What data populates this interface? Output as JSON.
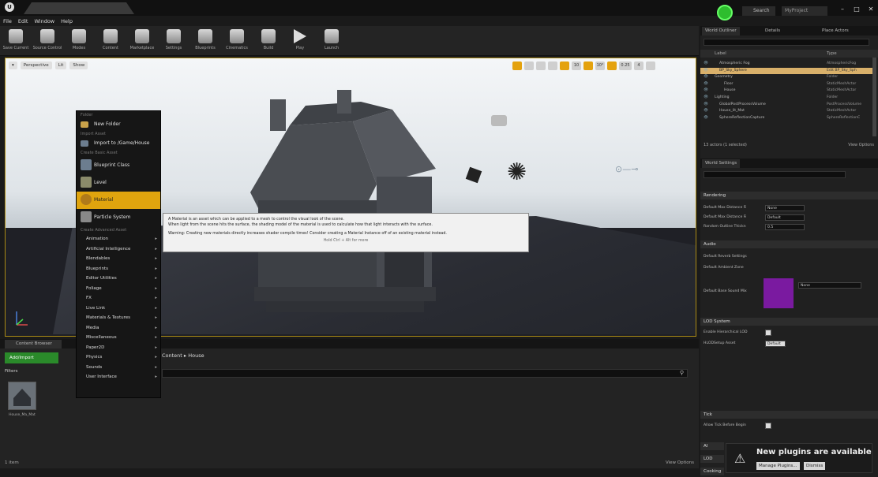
{
  "window": {
    "menu": [
      "File",
      "Edit",
      "Window",
      "Help"
    ],
    "search_label": "Search",
    "project_label": "MyProject"
  },
  "toolbar": {
    "buttons": [
      "Save Current",
      "Source Control",
      "Modes",
      "Content",
      "Marketplace",
      "Settings",
      "Blueprints",
      "Cinematics",
      "Build",
      "Play",
      "Launch"
    ]
  },
  "viewport": {
    "perspective": "Perspective",
    "lit": "Lit",
    "show": "Show",
    "snap_values": [
      "10",
      "10°",
      "0.25",
      "4"
    ]
  },
  "context_menu": {
    "folder_section": "Folder",
    "new_folder": "New Folder",
    "import_section": "Import Asset",
    "import_to": "Import to /Game/House",
    "basic_section": "Create Basic Asset",
    "basic_items": [
      "Blueprint Class",
      "Level",
      "Material",
      "Particle System"
    ],
    "advanced_section": "Create Advanced Asset",
    "advanced_items": [
      "Animation",
      "Artificial Intelligence",
      "Blendables",
      "Blueprints",
      "Editor Utilities",
      "Foliage",
      "FX",
      "Live Link",
      "Materials & Textures",
      "Media",
      "Miscellaneous",
      "Paper2D",
      "Physics",
      "Sounds",
      "User Interface"
    ]
  },
  "tooltip": {
    "line1": "A Material is an asset which can be applied to a mesh to control the visual look of the scene.",
    "line2": "When light from the scene hits the surface, the shading model of the material is used to calculate how that light interacts with the surface.",
    "line3": "Warning: Creating new materials directly increases shader compile times! Consider creating a Material Instance off of an existing material instead.",
    "hint": "Hold Ctrl + Alt for more"
  },
  "content_browser": {
    "tab": "Content Browser",
    "add_new": "Add/Import",
    "path": "Content ▸ House",
    "filters": "Filters",
    "asset_name": "House_Ma_Mat",
    "status": "1 item",
    "view_options": "View Options"
  },
  "outliner": {
    "tabs": [
      "World Outliner",
      "Details",
      "Place Actors"
    ],
    "columns": [
      "Label",
      "Type"
    ],
    "rows": [
      {
        "name": "Atmospheric Fog",
        "type": "AtmosphericFog",
        "indent": 1,
        "selected": false
      },
      {
        "name": "BP_Sky_Sphere",
        "type": "Edit BP_Sky_Sph",
        "indent": 1,
        "selected": true
      },
      {
        "name": "Geometry",
        "type": "Folder",
        "indent": 0,
        "selected": false
      },
      {
        "name": "Floor",
        "type": "StaticMeshActor",
        "indent": 2,
        "selected": false
      },
      {
        "name": "House",
        "type": "StaticMeshActor",
        "indent": 2,
        "selected": false
      },
      {
        "name": "Lighting",
        "type": "Folder",
        "indent": 0,
        "selected": false
      },
      {
        "name": "GlobalPostProcessVolume",
        "type": "PostProcessVolume",
        "indent": 1,
        "selected": false
      },
      {
        "name": "House_lit_Mat",
        "type": "StaticMeshActor",
        "indent": 1,
        "selected": false
      },
      {
        "name": "SphereReflectionCapture",
        "type": "SphereReflectionC",
        "indent": 1,
        "selected": false
      }
    ],
    "footer": "13 actors (1 selected)",
    "view_options": "View Options"
  },
  "world_settings": {
    "tab": "World Settings",
    "sections": {
      "rendering": "Rendering",
      "audio": "Audio",
      "lod": "LOD System",
      "tick": "Tick",
      "ai": "AI",
      "lod2": "LOD",
      "cooking": "Cooking"
    },
    "rendering_props": [
      {
        "label": "Default Max Distance Fi",
        "value": "None"
      },
      {
        "label": "Default Max Distance Fi",
        "value": "Default"
      },
      {
        "label": "Random Outline Thickn",
        "value": "0.5"
      }
    ],
    "audio_props": [
      "Default Reverb Settings",
      "Default Ambient Zone"
    ],
    "color_label": "Default Base Sound Mix",
    "color_value": "None",
    "lod_props": [
      "Enable Hierarchical LOD",
      "HLODSetup Asset"
    ],
    "hlod_value": "Default",
    "tick_prop": "Allow Tick Before Begin"
  },
  "notification": {
    "message": "New plugins are available",
    "buttons": [
      "Manage Plugins...",
      "Dismiss"
    ]
  }
}
